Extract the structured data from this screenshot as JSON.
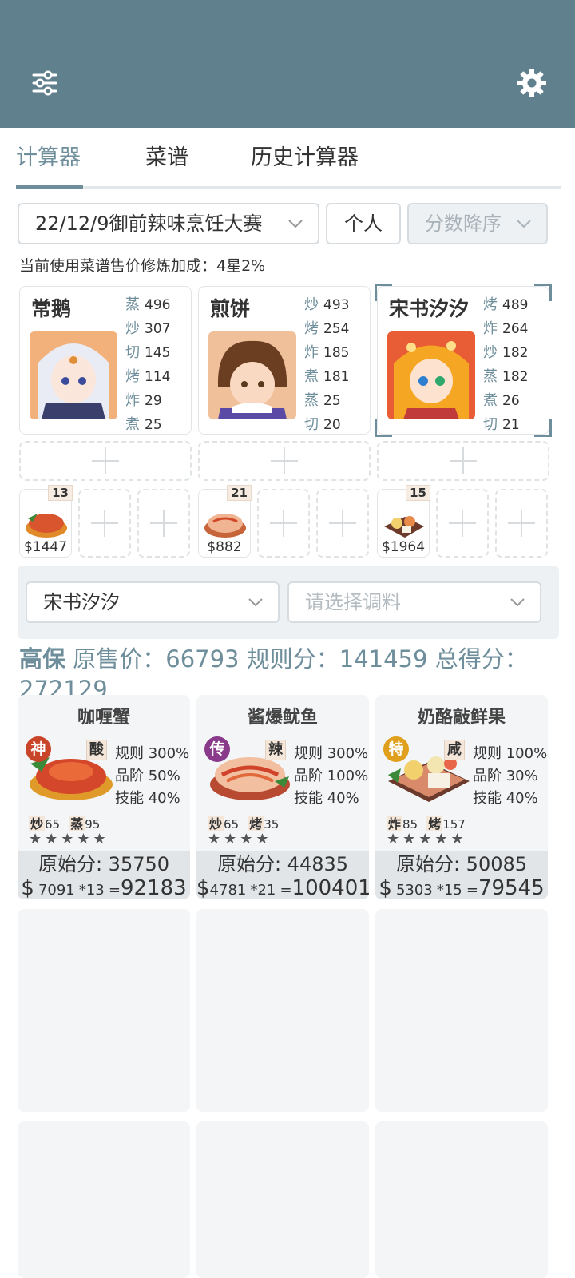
{
  "tabs": [
    {
      "label": "计算器"
    },
    {
      "label": "菜谱"
    },
    {
      "label": "历史计算器"
    }
  ],
  "controls": {
    "event": "22/12/9御前辣味烹饪大赛",
    "mode": "个人",
    "sort": "分数降序",
    "bonus_text": "当前使用菜谱售价修炼加成：4星2%"
  },
  "chefs": [
    {
      "name": "常鹅",
      "skills": [
        [
          "蒸",
          "496"
        ],
        [
          "炒",
          "307"
        ],
        [
          "切",
          "145"
        ],
        [
          "烤",
          "114"
        ],
        [
          "炸",
          "29"
        ],
        [
          "煮",
          "25"
        ]
      ],
      "dishes": [
        {
          "qty": "13",
          "price": "$1447"
        }
      ]
    },
    {
      "name": "煎饼",
      "skills": [
        [
          "炒",
          "493"
        ],
        [
          "烤",
          "254"
        ],
        [
          "炸",
          "185"
        ],
        [
          "煮",
          "181"
        ],
        [
          "蒸",
          "25"
        ],
        [
          "切",
          "20"
        ]
      ],
      "dishes": [
        {
          "qty": "21",
          "price": "$882"
        }
      ]
    },
    {
      "name": "宋书汐汐",
      "skills": [
        [
          "烤",
          "489"
        ],
        [
          "炸",
          "264"
        ],
        [
          "炒",
          "182"
        ],
        [
          "蒸",
          "182"
        ],
        [
          "煮",
          "26"
        ],
        [
          "切",
          "21"
        ]
      ],
      "dishes": [
        {
          "qty": "15",
          "price": "$1964"
        }
      ]
    }
  ],
  "filter": {
    "chef_select": "宋书汐汐",
    "seasoning_placeholder": "请选择调料"
  },
  "summary": {
    "label": "高保",
    "text1": "原售价：",
    "orig_price": "66793",
    "text2": "规则分：",
    "rule_score": "141459",
    "text3": "总得分：",
    "total": "272129"
  },
  "recipes": [
    {
      "name": "咖喱蟹",
      "rank": "神",
      "rank_color": "#c8452a",
      "flavor": "酸",
      "stats": [
        "规则 300%",
        "品阶 50%",
        "技能 40%"
      ],
      "skills": [
        [
          "炒",
          "65"
        ],
        [
          "蒸",
          "95"
        ]
      ],
      "stars": "★★★★★",
      "orig": "原始分: 35750",
      "unit": "7091",
      "mult": "*13",
      "result": "92183"
    },
    {
      "name": "酱爆鱿鱼",
      "rank": "传",
      "rank_color": "#8a3a8a",
      "flavor": "辣",
      "stats": [
        "规则 300%",
        "品阶 100%",
        "技能 40%"
      ],
      "skills": [
        [
          "炒",
          "65"
        ],
        [
          "烤",
          "35"
        ]
      ],
      "stars": "★★★★",
      "orig": "原始分: 44835",
      "unit": "4781",
      "mult": "*21",
      "result": "100401"
    },
    {
      "name": "奶酪敲鲜果",
      "rank": "特",
      "rank_color": "#e0a01e",
      "flavor": "咸",
      "stats": [
        "规则 100%",
        "品阶 30%",
        "技能 40%"
      ],
      "skills": [
        [
          "炸",
          "85"
        ],
        [
          "烤",
          "157"
        ]
      ],
      "stars": "★★★★★",
      "orig": "原始分: 50085",
      "unit": "5303",
      "mult": "*15",
      "result": "79545"
    }
  ],
  "colors": {
    "header": "#60808d",
    "accent": "#6e8e9b"
  }
}
